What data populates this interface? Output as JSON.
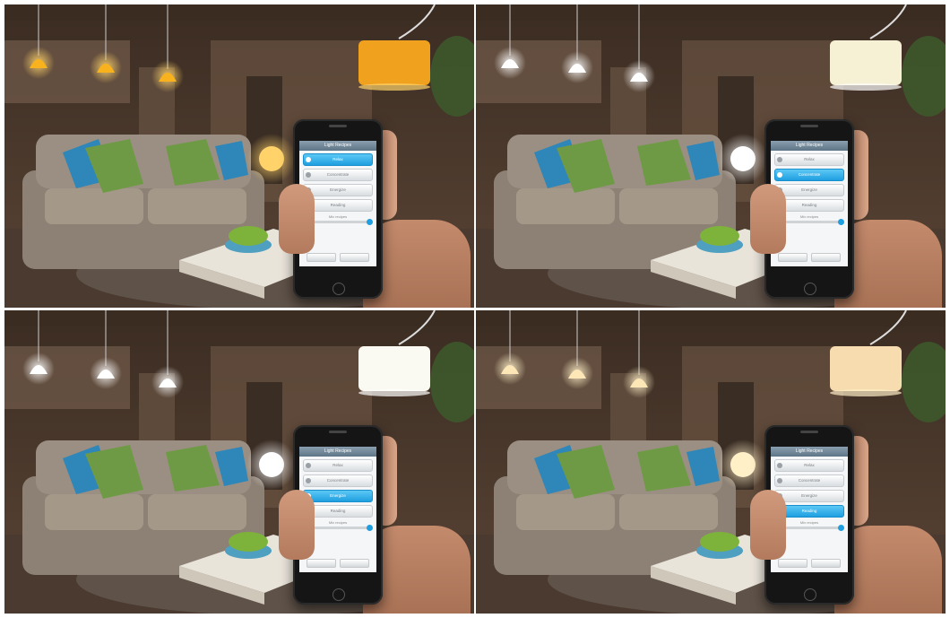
{
  "panels": [
    {
      "id": "relax",
      "lamp_color": "#f0a21e",
      "pendant_color": "#f7b21d",
      "orb_color": "#ffd36a",
      "screen": {
        "title": "Light Recipes",
        "items": [
          {
            "label": "Relax",
            "active": true
          },
          {
            "label": "Concentrate",
            "active": false
          },
          {
            "label": "Energize",
            "active": false
          },
          {
            "label": "Reading",
            "active": false
          }
        ],
        "mix_label": "Mix recipes"
      }
    },
    {
      "id": "concentrate",
      "lamp_color": "#f6f1d4",
      "pendant_color": "#ffffff",
      "orb_color": "#ffffff",
      "screen": {
        "title": "Light Recipes",
        "items": [
          {
            "label": "Relax",
            "active": false
          },
          {
            "label": "Concentrate",
            "active": true
          },
          {
            "label": "Energize",
            "active": false
          },
          {
            "label": "Reading",
            "active": false
          }
        ],
        "mix_label": "Mix recipes"
      }
    },
    {
      "id": "energize",
      "lamp_color": "#fbfaf2",
      "pendant_color": "#ffffff",
      "orb_color": "#ffffff",
      "screen": {
        "title": "Light Recipes",
        "items": [
          {
            "label": "Relax",
            "active": false
          },
          {
            "label": "Concentrate",
            "active": false
          },
          {
            "label": "Energize",
            "active": true
          },
          {
            "label": "Reading",
            "active": false
          }
        ],
        "mix_label": "Mix recipes"
      }
    },
    {
      "id": "reading",
      "lamp_color": "#f6dcae",
      "pendant_color": "#fde7b6",
      "orb_color": "#fff0c8",
      "screen": {
        "title": "Light Recipes",
        "items": [
          {
            "label": "Relax",
            "active": false
          },
          {
            "label": "Concentrate",
            "active": false
          },
          {
            "label": "Energize",
            "active": false
          },
          {
            "label": "Reading",
            "active": true
          }
        ],
        "mix_label": "Mix recipes"
      }
    }
  ],
  "colors": {
    "wall": "#5a4536",
    "ceiling": "#3b2c22",
    "sofa": "#8d8175",
    "cushion_green": "#6f9a45",
    "cushion_blue": "#2f86b8",
    "table": "#e9e4da",
    "apples": "#7db33a",
    "floor": "#4a3a30"
  }
}
